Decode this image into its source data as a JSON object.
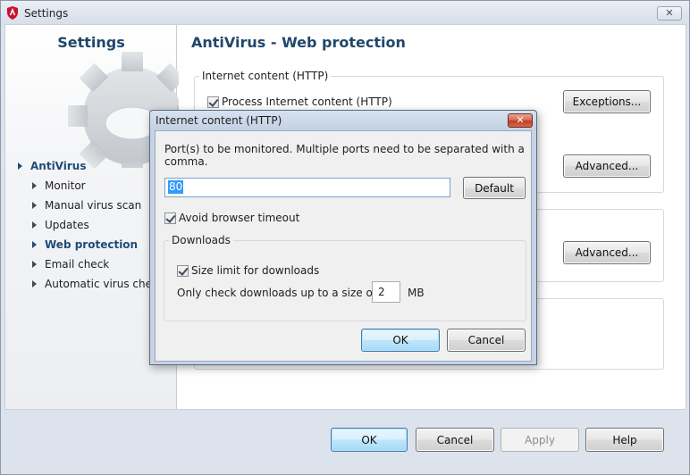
{
  "window": {
    "title": "Settings"
  },
  "sidebar": {
    "title": "Settings",
    "items": [
      {
        "label": "AntiVirus",
        "active": true,
        "level": 0
      },
      {
        "label": "Monitor",
        "active": false,
        "level": 1
      },
      {
        "label": "Manual virus scan",
        "active": false,
        "level": 1
      },
      {
        "label": "Updates",
        "active": false,
        "level": 1
      },
      {
        "label": "Web protection",
        "active": true,
        "level": 1
      },
      {
        "label": "Email check",
        "active": false,
        "level": 1
      },
      {
        "label": "Automatic virus check",
        "active": false,
        "level": 1
      }
    ]
  },
  "main": {
    "title": "AntiVirus - Web protection",
    "group1": {
      "legend": "Internet content (HTTP)",
      "checkbox_label": "Process Internet content (HTTP)",
      "checked": true,
      "exceptions_button": "Exceptions...",
      "advanced_button": "Advanced..."
    },
    "group2": {
      "advanced_button": "Advanced..."
    }
  },
  "footer": {
    "ok": "OK",
    "cancel": "Cancel",
    "apply": "Apply",
    "help": "Help"
  },
  "dialog": {
    "title": "Internet content (HTTP)",
    "instruction": "Port(s) to be monitored. Multiple ports need to be separated with a comma.",
    "port_value": "80",
    "default_button": "Default",
    "avoid_timeout_label": "Avoid browser timeout",
    "avoid_timeout_checked": true,
    "downloads": {
      "legend": "Downloads",
      "size_limit_label": "Size limit for downloads",
      "size_limit_checked": true,
      "only_check_label": "Only check downloads up to a size of",
      "size_value": "2",
      "unit": "MB"
    },
    "ok": "OK",
    "cancel": "Cancel"
  },
  "colors": {
    "heading": "#20476b",
    "accent_selection": "#3399ff",
    "close_red": "#c33a22"
  }
}
